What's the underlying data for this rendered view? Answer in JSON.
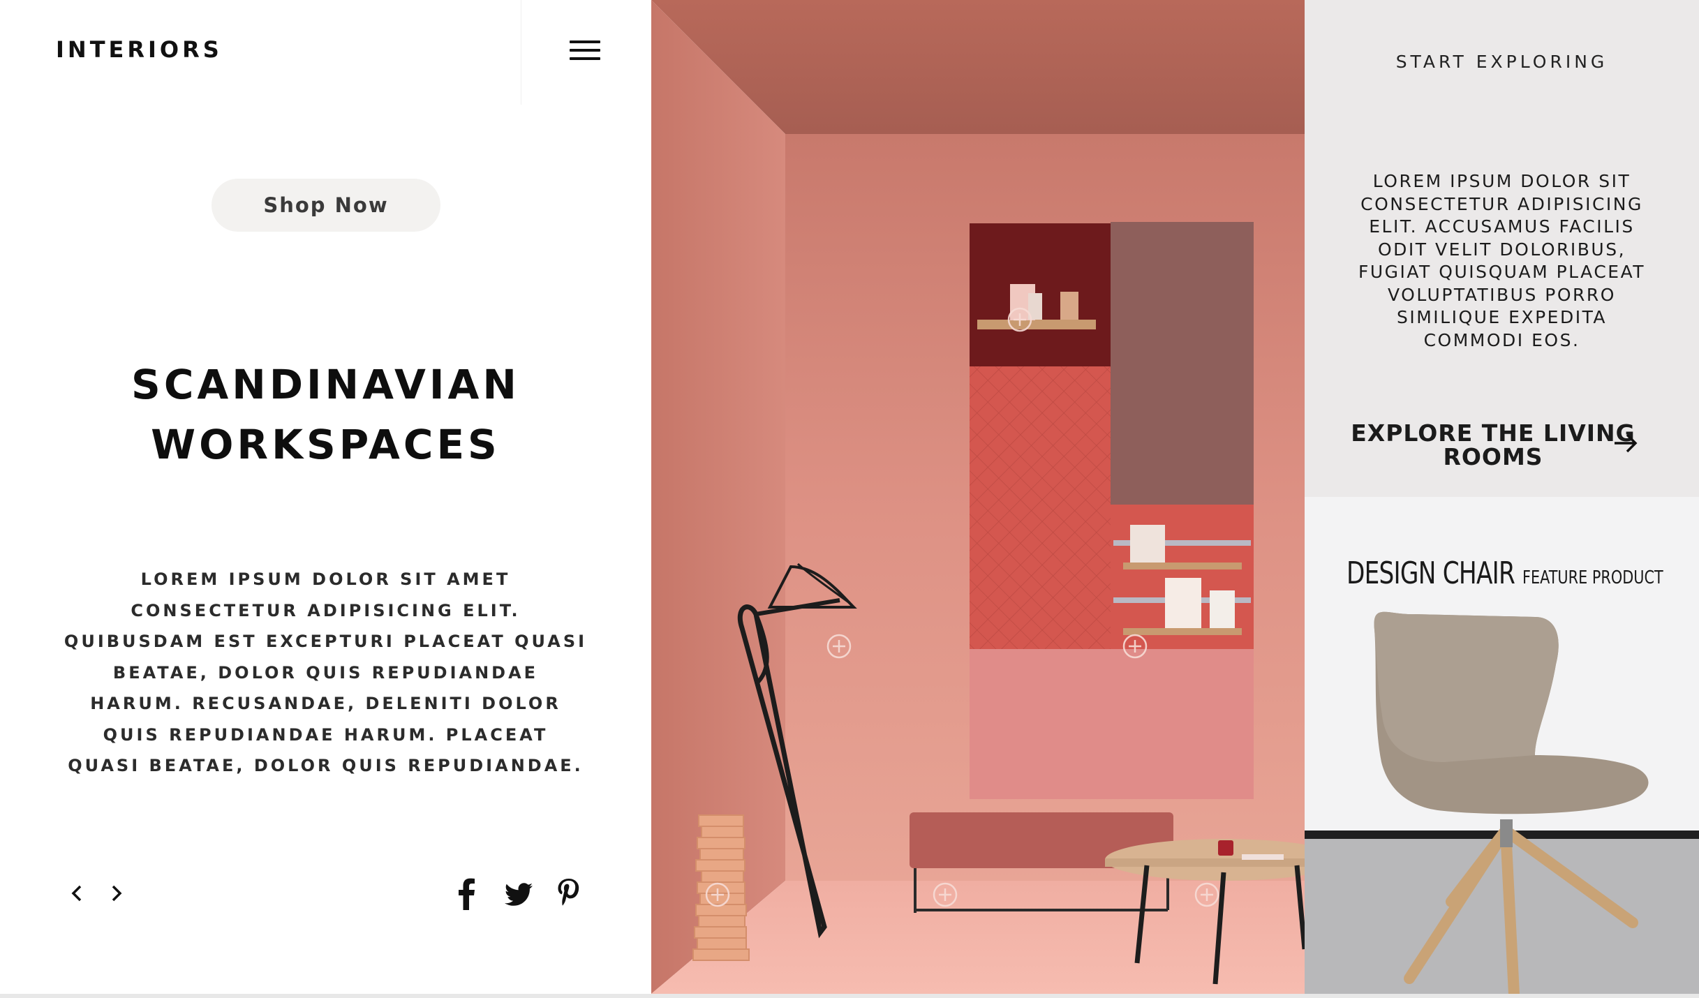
{
  "header": {
    "brand": "INTERIORS",
    "menu_icon": "hamburger-menu-icon"
  },
  "hero": {
    "shop_button": "Shop Now",
    "title_line1": "SCANDINAVIAN",
    "title_line2": "WORKSPACES",
    "body": "LOREM IPSUM DOLOR SIT AMET CONSECTETUR ADIPISICING ELIT. QUIBUSDAM EST EXCEPTURI PLACEAT QUASI BEATAE, DOLOR QUIS REPUDIANDAE HARUM. RECUSANDAE, DELENITI DOLOR QUIS REPUDIANDAE HARUM. PLACEAT QUASI BEATAE, DOLOR QUIS REPUDIANDAE."
  },
  "navigation": {
    "prev_icon": "chevron-left-icon",
    "next_icon": "chevron-right-icon"
  },
  "social": {
    "icons": [
      "facebook-icon",
      "twitter-icon",
      "pinterest-icon"
    ]
  },
  "sidebar": {
    "heading": "START EXPLORING",
    "text": "LOREM IPSUM DOLOR SIT CONSECTETUR ADIPISICING ELIT. ACCUSAMUS FACILIS ODIT VELIT DOLORIBUS, FUGIAT QUISQUAM PLACEAT VOLUPTATIBUS PORRO SIMILIQUE EXPEDITA COMMODI EOS.",
    "link_line1": "EXPLORE THE LIVING",
    "link_line2": "ROOMS",
    "link_icon": "arrow-right-icon"
  },
  "feature": {
    "title": "DESIGN CHAIR",
    "subtitle": "FEATURE PRODUCT"
  },
  "colors": {
    "room_pink": "#e09a8e",
    "panel_gray": "#ebe9e9",
    "dark_red": "#6d1a1c",
    "quilted_red": "#d45a52"
  }
}
